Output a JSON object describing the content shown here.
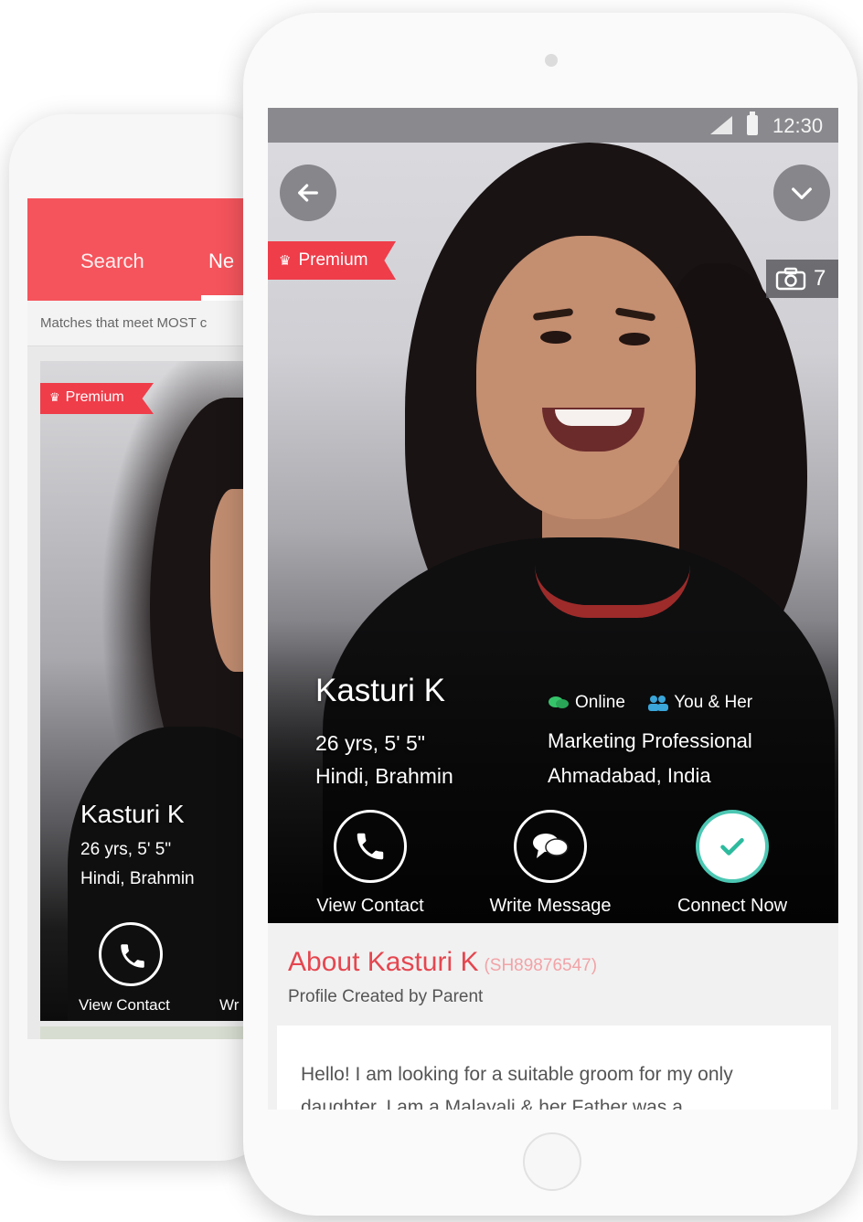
{
  "colors": {
    "brand_red": "#f5545c",
    "premium_red": "#ef3d4a",
    "connect_teal": "#4cc7b3",
    "about_title": "#e5464f"
  },
  "back_phone": {
    "tabs": [
      "Search",
      "Ne"
    ],
    "subtitle": "Matches that meet MOST c",
    "premium_label": "Premium",
    "profile": {
      "name": "Kasturi K",
      "age_height": "26 yrs, 5' 5\"",
      "community": "Hindi, Brahmin"
    },
    "actions": {
      "view_contact": "View Contact",
      "partial_next": "Wr"
    }
  },
  "front_phone": {
    "status": {
      "time": "12:30",
      "icons": [
        "signal-icon",
        "battery-icon"
      ]
    },
    "nav": {
      "back_icon": "arrow-left-icon",
      "expand_icon": "chevron-down-icon"
    },
    "premium_label": "Premium",
    "photo_count": "7",
    "profile": {
      "name": "Kasturi K",
      "age_height": "26 yrs, 5' 5\"",
      "community": "Hindi, Brahmin",
      "online": "Online",
      "mutual": "You & Her",
      "profession": "Marketing Professional",
      "location": "Ahmadabad, India"
    },
    "actions": [
      {
        "label": "View Contact",
        "icon": "phone-icon"
      },
      {
        "label": "Write Message",
        "icon": "chat-icon"
      },
      {
        "label": "Connect Now",
        "icon": "check-icon"
      }
    ],
    "about": {
      "title": "About Kasturi K",
      "id": "(SH89876547)",
      "created_by": "Profile Created by Parent",
      "text": "Hello! I am looking for a suitable groom for my only daughter. I am a Malayali & her Father was a"
    }
  }
}
